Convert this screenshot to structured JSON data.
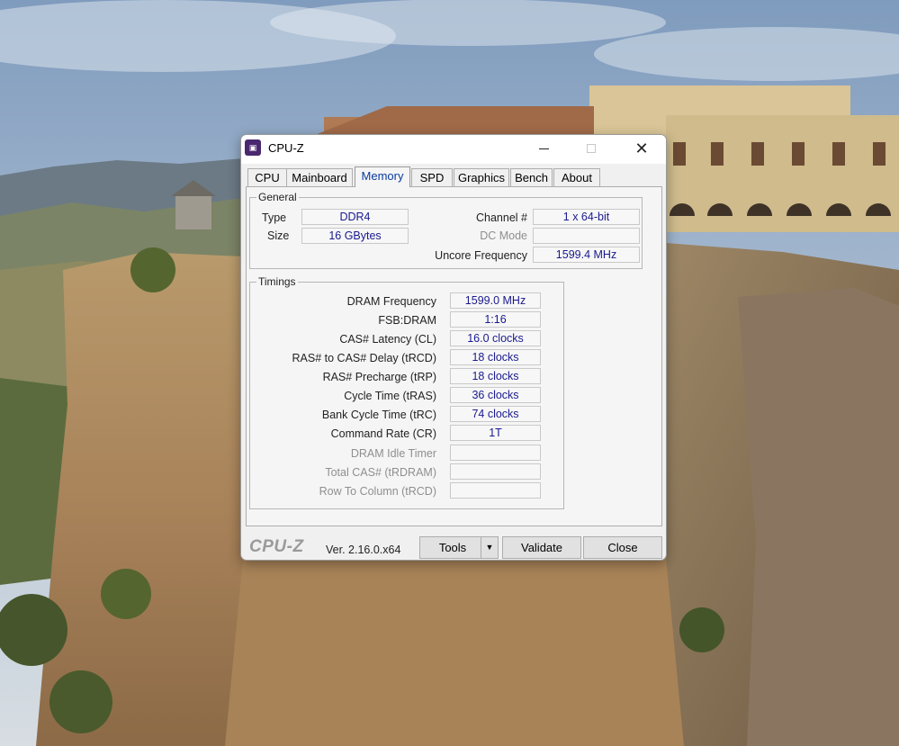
{
  "window": {
    "title": "CPU-Z",
    "app_icon": "cpu-z-app-icon",
    "controls": {
      "minimize_icon": "minimize-icon",
      "maximize_icon": "maximize-icon",
      "close_icon": "close-icon",
      "close_glyph": "✕"
    }
  },
  "tabs": [
    {
      "label": "CPU"
    },
    {
      "label": "Mainboard"
    },
    {
      "label": "Memory",
      "active": true
    },
    {
      "label": "SPD"
    },
    {
      "label": "Graphics"
    },
    {
      "label": "Bench"
    },
    {
      "label": "About"
    }
  ],
  "general": {
    "title": "General",
    "type_label": "Type",
    "type_value": "DDR4",
    "size_label": "Size",
    "size_value": "16 GBytes",
    "channel_label": "Channel #",
    "channel_value": "1 x 64-bit",
    "dc_mode_label": "DC Mode",
    "dc_mode_value": "",
    "uncore_label": "Uncore Frequency",
    "uncore_value": "1599.4 MHz"
  },
  "timings": {
    "title": "Timings",
    "rows": [
      {
        "label": "DRAM Frequency",
        "value": "1599.0 MHz",
        "enabled": true
      },
      {
        "label": "FSB:DRAM",
        "value": "1:16",
        "enabled": true
      },
      {
        "label": "CAS# Latency (CL)",
        "value": "16.0 clocks",
        "enabled": true
      },
      {
        "label": "RAS# to CAS# Delay (tRCD)",
        "value": "18 clocks",
        "enabled": true
      },
      {
        "label": "RAS# Precharge (tRP)",
        "value": "18 clocks",
        "enabled": true
      },
      {
        "label": "Cycle Time (tRAS)",
        "value": "36 clocks",
        "enabled": true
      },
      {
        "label": "Bank Cycle Time (tRC)",
        "value": "74 clocks",
        "enabled": true
      },
      {
        "label": "Command Rate (CR)",
        "value": "1T",
        "enabled": true
      },
      {
        "label": "DRAM Idle Timer",
        "value": "",
        "enabled": false
      },
      {
        "label": "Total CAS# (tRDRAM)",
        "value": "",
        "enabled": false
      },
      {
        "label": "Row To Column (tRCD)",
        "value": "",
        "enabled": false
      }
    ]
  },
  "footer": {
    "brand": "CPU-Z",
    "version": "Ver. 2.16.0.x64",
    "tools_label": "Tools",
    "tools_arrow": "▼",
    "validate_label": "Validate",
    "close_label": "Close"
  },
  "colors": {
    "value_text": "#1a1a8e",
    "active_tab_text": "#0a3a9e",
    "app_icon_bg": "#4a2870"
  }
}
